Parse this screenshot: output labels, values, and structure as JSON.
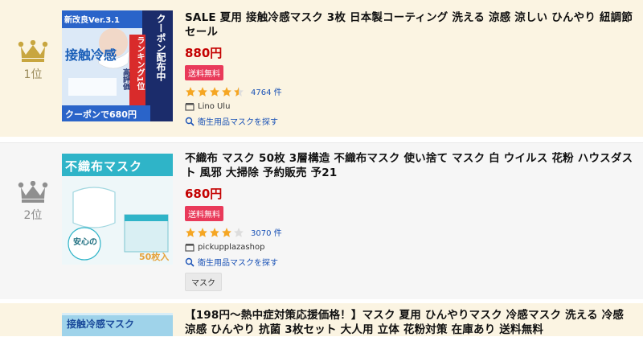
{
  "items": [
    {
      "rank_label": "1位",
      "thumb_text": {
        "top_left": "新改良Ver.3.1",
        "main": "接触冷感",
        "side_vertical": "クーポン配布中",
        "banner": "ランキング1位",
        "sub": "高評価",
        "bottom": "クーポンで680円"
      },
      "title": "SALE 夏用 接触冷感マスク 3枚 日本製コーティング 洗える 涼感 涼しい ひんやり 紐調節 セール",
      "price": "880円",
      "badge": "送料無料",
      "rating": 4.5,
      "reviews": "4764 件",
      "shop": "Lino Ulu",
      "search_link": "衛生用品マスクを探す"
    },
    {
      "rank_label": "2位",
      "thumb_text": {
        "header": "不織布マスク",
        "side": "安心の",
        "count": "50枚入り"
      },
      "title": "不織布 マスク 50枚 3層構造 不織布マスク 使い捨て マスク 白 ウイルス 花粉 ハウスダスト 風邪 大掃除 予約販売 予21",
      "price": "680円",
      "badge": "送料無料",
      "rating": 4,
      "reviews": "3070 件",
      "shop": "pickupplazashop",
      "search_link": "衛生用品マスクを探す",
      "tag": "マスク"
    },
    {
      "thumb_text": {
        "header": "接触冷感マスク"
      },
      "title": "【198円～熱中症対策応援価格！】マスク 夏用 ひんやりマスク 冷感マスク 洗える 冷感 涼感 ひんやり 抗菌 3枚セット 大人用 立体 花粉対策 在庫あり 送料無料"
    }
  ],
  "colors": {
    "gold_crown": "#c8a640",
    "silver_crown": "#8f8f8f",
    "price_red": "#c40000",
    "badge_pink": "#e93a5a",
    "star": "#f5a623",
    "link_blue": "#1a52b6",
    "row_bg_gold": "#fbf4e2",
    "row_bg_gray": "#f6f6f6"
  },
  "icons": {
    "crown": "crown-icon",
    "star": "star-icon",
    "shop": "shop-icon",
    "search": "search-icon"
  }
}
